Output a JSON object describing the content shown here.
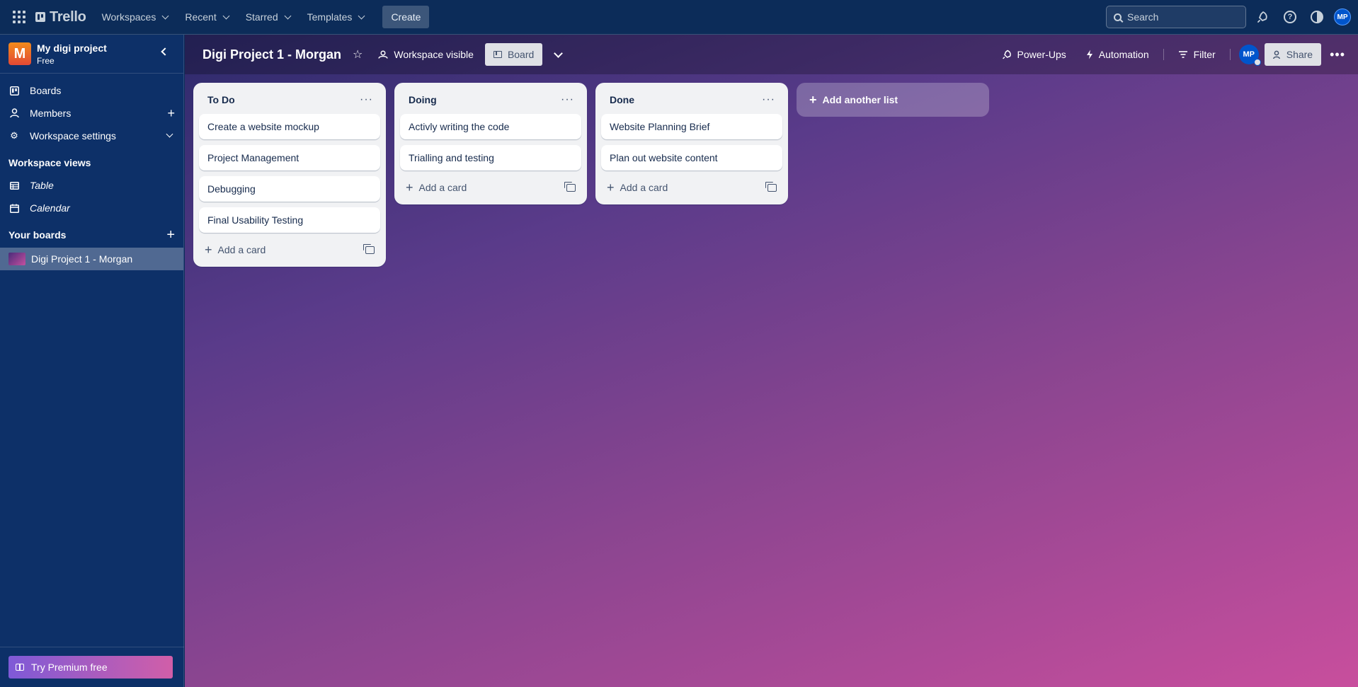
{
  "topbar": {
    "logo_text": "Trello",
    "nav": [
      {
        "label": "Workspaces"
      },
      {
        "label": "Recent"
      },
      {
        "label": "Starred"
      },
      {
        "label": "Templates"
      }
    ],
    "create_label": "Create",
    "search_placeholder": "Search",
    "avatar_initials": "MP"
  },
  "sidebar": {
    "workspace_initial": "M",
    "workspace_name": "My digi project",
    "workspace_plan": "Free",
    "menu": [
      {
        "label": "Boards"
      },
      {
        "label": "Members"
      },
      {
        "label": "Workspace settings"
      }
    ],
    "views_heading": "Workspace views",
    "views": [
      {
        "label": "Table"
      },
      {
        "label": "Calendar"
      }
    ],
    "boards_heading": "Your boards",
    "boards": [
      {
        "label": "Digi Project 1 - Morgan"
      }
    ],
    "premium_label": "Try Premium free"
  },
  "board": {
    "title": "Digi Project 1 - Morgan",
    "visibility_label": "Workspace visible",
    "view_label": "Board",
    "powerups_label": "Power-Ups",
    "automation_label": "Automation",
    "filter_label": "Filter",
    "member_initials": "MP",
    "share_label": "Share",
    "add_list_label": "Add another list",
    "lists": [
      {
        "title": "To Do",
        "cards": [
          "Create a website mockup",
          "Project Management",
          "Debugging",
          "Final Usability Testing"
        ],
        "add_card_label": "Add a card"
      },
      {
        "title": "Doing",
        "cards": [
          "Activly writing the code",
          "Trialling and testing"
        ],
        "add_card_label": "Add a card"
      },
      {
        "title": "Done",
        "cards": [
          "Website Planning Brief",
          "Plan out website content"
        ],
        "add_card_label": "Add a card"
      }
    ]
  },
  "colors": {
    "topbar_bg": "#0c2c59",
    "sidebar_bg": "#0d3068",
    "board_gradient_start": "#2d2a6b",
    "board_gradient_end": "#c84e9d",
    "list_bg": "#f1f2f4",
    "card_text": "#172b4d"
  }
}
